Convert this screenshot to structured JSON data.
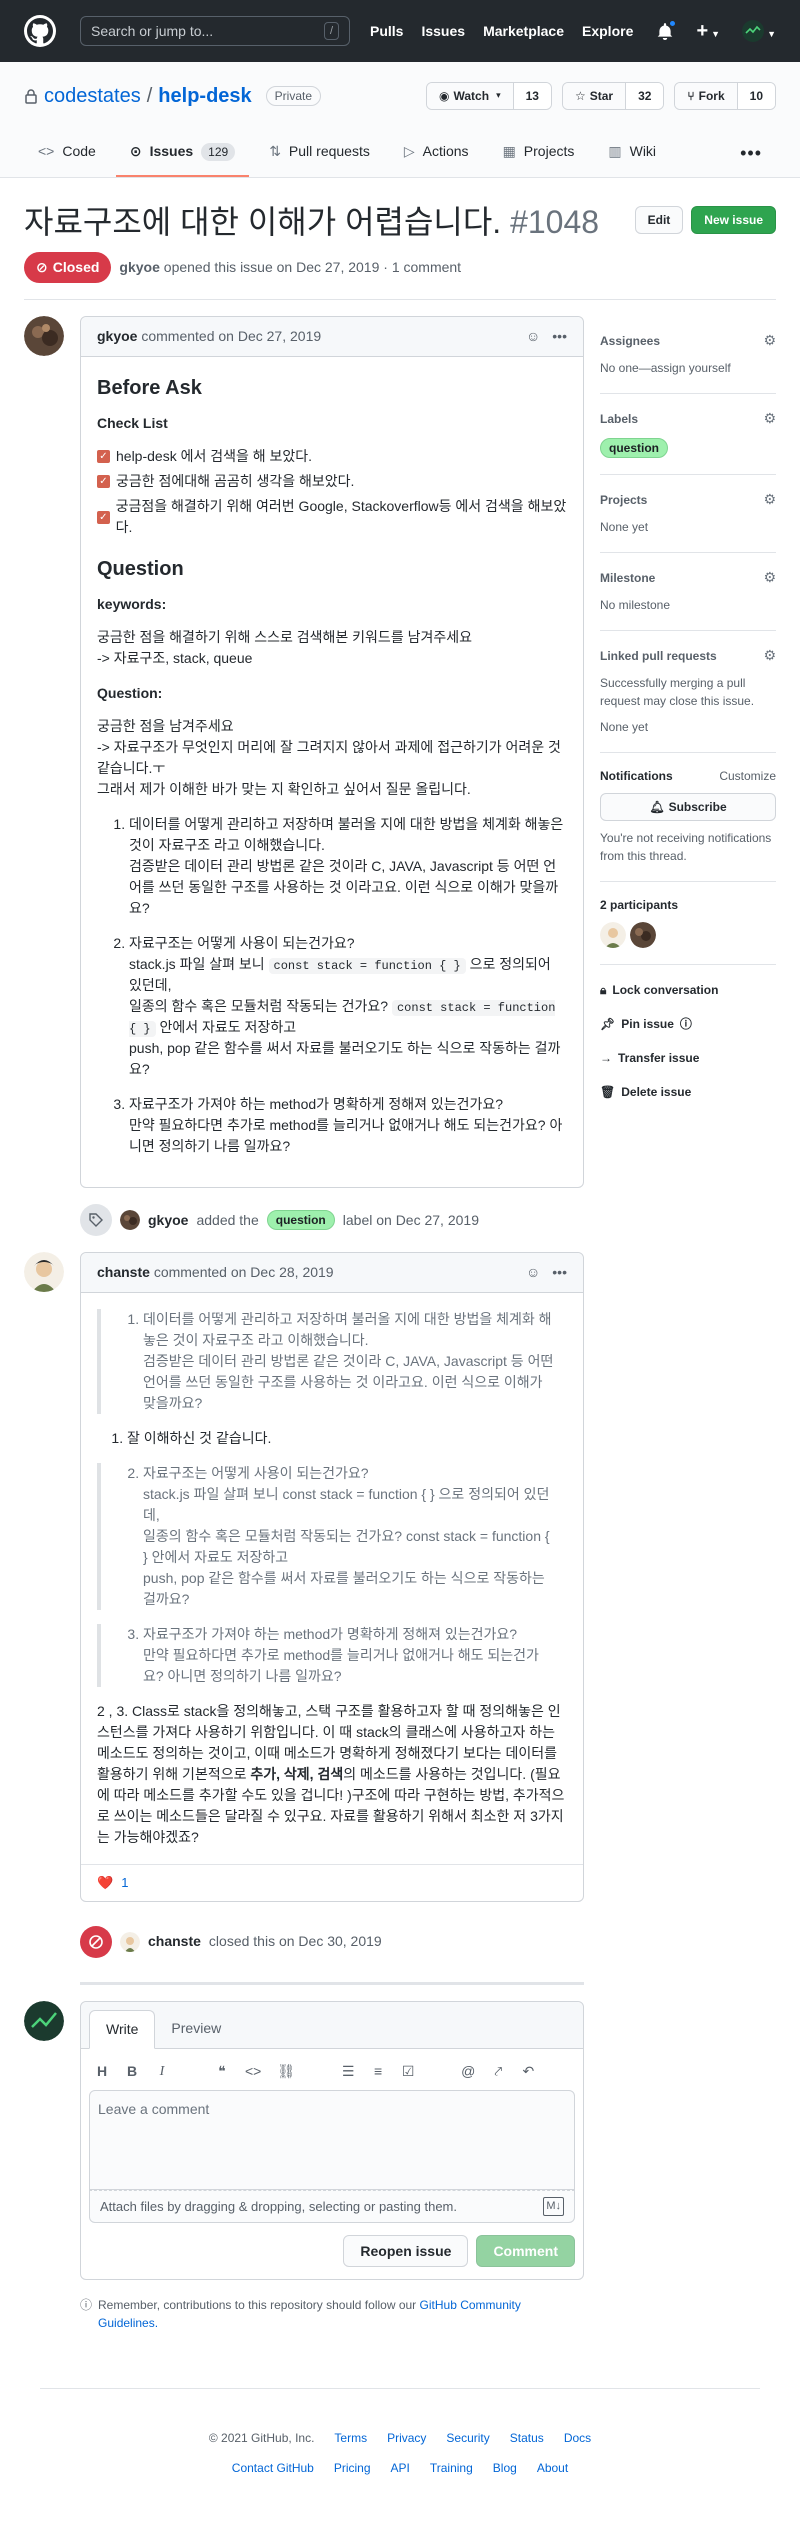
{
  "header": {
    "search_placeholder": "Search or jump to...",
    "search_shortcut": "/",
    "nav": [
      "Pulls",
      "Issues",
      "Marketplace",
      "Explore"
    ]
  },
  "repo": {
    "owner": "codestates",
    "separator": "/",
    "name": "help-desk",
    "visibility": "Private",
    "watch_label": "Watch",
    "watch_count": "13",
    "star_label": "Star",
    "star_count": "32",
    "fork_label": "Fork",
    "fork_count": "10",
    "tabs": [
      {
        "label": "Code",
        "icon": "code-icon"
      },
      {
        "label": "Issues",
        "icon": "issue-icon",
        "count": "129"
      },
      {
        "label": "Pull requests",
        "icon": "pull-request-icon"
      },
      {
        "label": "Actions",
        "icon": "play-icon"
      },
      {
        "label": "Projects",
        "icon": "project-icon"
      },
      {
        "label": "Wiki",
        "icon": "book-icon"
      }
    ]
  },
  "issue": {
    "title": "자료구조에 대한 이해가 어렵습니다.",
    "number": "#1048",
    "edit_label": "Edit",
    "new_issue_label": "New issue",
    "state": "Closed",
    "author": "gkyoe",
    "meta": "opened this issue on Dec 27, 2019 · 1 comment"
  },
  "comment1": {
    "author": "gkyoe",
    "meta": "commented on Dec 27, 2019",
    "before_ask": "Before Ask",
    "check_list": "Check List",
    "tasks": [
      "help-desk 에서 검색을 해 보았다.",
      "궁금한 점에대해 곰곰히 생각을 해보았다.",
      "궁금점을 해결하기 위해 여러번 Google, Stackoverflow등 에서 검색을 해보았다."
    ],
    "question_heading": "Question",
    "keywords_label": "keywords:",
    "keywords_line1": "궁금한 점을 해결하기 위해 스스로 검색해본 키워드를 남겨주세요",
    "keywords_line2": "-> 자료구조, stack, queue",
    "question_label": "Question:",
    "question_line1": "궁금한 점을 남겨주세요",
    "question_line2": "-> 자료구조가 무엇인지 머리에 잘 그려지지 않아서 과제에 접근하기가 어려운 것 같습니다.ㅜ",
    "question_line3": "그래서 제가 이해한 바가 맞는 지 확인하고 싶어서 질문 올립니다.",
    "q1": "데이터를 어떻게 관리하고 저장하며 불러올 지에 대한 방법을 체계화 해놓은 것이 자료구조 라고 이해했습니다.",
    "q1b": "검증받은 데이터 관리 방법론 같은 것이라 C, JAVA, Javascript 등 어떤 언어를 쓰던 동일한 구조를 사용하는 것 이라고요. 이런 식으로 이해가 맞을까요?",
    "q2": "자료구조는 어떻게 사용이 되는건가요?",
    "q2_a": "stack.js 파일 살펴 보니",
    "q2_code1": "const stack = function { }",
    "q2_b": "으로 정의되어 있던데,",
    "q2_c": "일종의 함수 혹은 모듈처럼 작동되는 건가요?",
    "q2_code2": "const stack = function { }",
    "q2_d": "안에서 자료도 저장하고",
    "q2_e": "push, pop 같은 함수를 써서 자료를 불러오기도 하는 식으로 작동하는 걸까요?",
    "q3": "자료구조가 가져야 하는 method가 명확하게 정해져 있는건가요?",
    "q3b": "만약 필요하다면 추가로 method를 늘리거나 없애거나 해도 되는건가요? 아니면 정의하기 나름 일까요?"
  },
  "event_label": {
    "author": "gkyoe",
    "text1": "added the",
    "label": "question",
    "text2": "label on Dec 27, 2019"
  },
  "comment2": {
    "author": "chanste",
    "meta": "commented on Dec 28, 2019",
    "bq1_a": "데이터를 어떻게 관리하고 저장하며 불러올 지에 대한 방법을 체계화 해놓은 것이 자료구조 라고 이해했습니다.",
    "bq1_b": "검증받은 데이터 관리 방법론 같은 것이라 C, JAVA, Javascript 등 어떤 언어를 쓰던 동일한 구조를 사용하는 것 이라고요. 이런 식으로 이해가 맞을까요?",
    "answer1": "잘 이해하신 것 같습니다.",
    "bq2_a": "자료구조는 어떻게 사용이 되는건가요?",
    "bq2_b": "stack.js 파일 살펴 보니 const stack = function { } 으로 정의되어 있던데,",
    "bq2_c": "일종의 함수 혹은 모듈처럼 작동되는 건가요? const stack = function { } 안에서 자료도 저장하고",
    "bq2_d": "push, pop 같은 함수를 써서 자료를 불러오기도 하는 식으로 작동하는 걸까요?",
    "bq3_a": "자료구조가 가져야 하는 method가 명확하게 정해져 있는건가요?",
    "bq3_b": "만약 필요하다면 추가로 method를 늘리거나 없애거나 해도 되는건가요? 아니면 정의하기 나름 일까요?",
    "answer_p1": "2 , 3. Class로 stack을 정의해놓고, 스택 구조를 활용하고자 할 때 정의해놓은 인스턴스를 가져다 사용하기 위함입니다. 이 때 stack의 클래스에 사용하고자 하는 메소드도 정의하는 것이고, 이때 메소드가 명확하게 정해졌다기 보다는 데이터를 활용하기 위해 기본적으로",
    "answer_b1": "추가, 삭제, 검색",
    "answer_p2": "의 메소드를 사용하는 것입니다. (필요에 따라 메소드를 추가할 수도 있을 겁니다! )구조에 따라 구현하는 방법, 추가적으로 쓰이는 메소드들은 달라질 수 있구요. 자료를 활용하기 위해서 최소한 저 3가지는 가능해야겠죠?",
    "reaction_emoji": "❤️",
    "reaction_count": "1"
  },
  "event_closed": {
    "author": "chanste",
    "text": "closed this on Dec 30, 2019"
  },
  "composer": {
    "tab_write": "Write",
    "tab_preview": "Preview",
    "placeholder": "Leave a comment",
    "attach_text": "Attach files by dragging & dropping, selecting or pasting them.",
    "reopen_label": "Reopen issue",
    "comment_label": "Comment",
    "remember_text": "Remember, contributions to this repository should follow our",
    "remember_link": "GitHub Community Guidelines."
  },
  "sidebar": {
    "assignees_label": "Assignees",
    "assignees_value": "No one—assign yourself",
    "labels_label": "Labels",
    "labels_value": "question",
    "projects_label": "Projects",
    "projects_value": "None yet",
    "milestone_label": "Milestone",
    "milestone_value": "No milestone",
    "linked_label": "Linked pull requests",
    "linked_desc": "Successfully merging a pull request may close this issue.",
    "linked_value": "None yet",
    "notifications_label": "Notifications",
    "customize_label": "Customize",
    "subscribe_label": "Subscribe",
    "notif_desc": "You're not receiving notifications from this thread.",
    "participants_label": "2 participants",
    "lock_label": "Lock conversation",
    "pin_label": "Pin issue",
    "transfer_label": "Transfer issue",
    "delete_label": "Delete issue"
  },
  "footer": {
    "copyright": "© 2021 GitHub, Inc.",
    "row1": [
      "Terms",
      "Privacy",
      "Security",
      "Status",
      "Docs"
    ],
    "row2": [
      "Contact GitHub",
      "Pricing",
      "API",
      "Training",
      "Blog",
      "About"
    ]
  },
  "colors": {
    "closed": "#d73a49",
    "accent": "#0366d6",
    "label_question": "#9ef0ad",
    "new_issue": "#2ea44f"
  }
}
